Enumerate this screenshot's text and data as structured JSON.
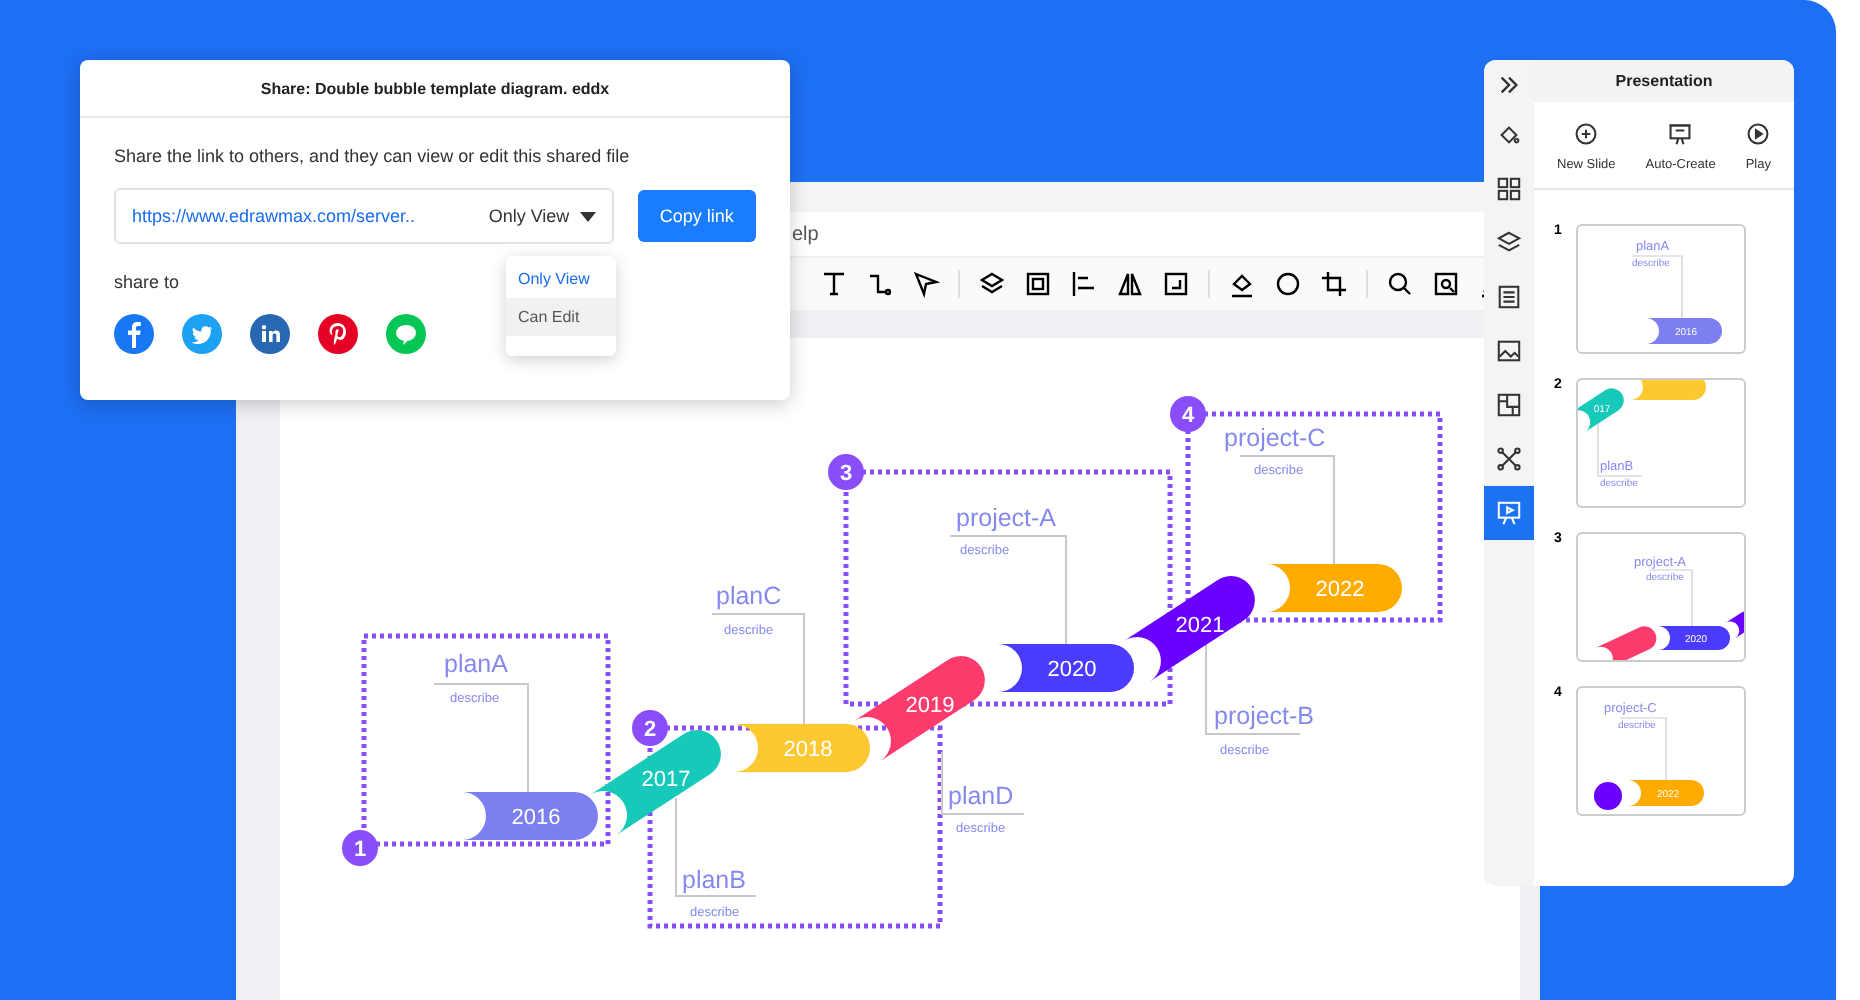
{
  "share_dialog": {
    "title": "Share: Double bubble template diagram. eddx",
    "message": "Share the link to others, and they can view or edit this shared file",
    "link_field": {
      "value": "https://www.edrawmax.com/server.."
    },
    "permission_select": {
      "value": "Only View"
    },
    "copy_button": "Copy link",
    "permission_options": [
      {
        "label": "Only View",
        "selected": true,
        "highlighted": false
      },
      {
        "label": "Can Edit",
        "selected": false,
        "highlighted": true
      }
    ],
    "share_label": "share to"
  },
  "editor": {
    "menu_text": "elp"
  },
  "diagram": {
    "frames": [
      {
        "number": "1"
      },
      {
        "number": "2"
      },
      {
        "number": "3"
      },
      {
        "number": "4"
      }
    ],
    "milestones": [
      {
        "year": "2016",
        "color": "#7b7fef"
      },
      {
        "year": "2017",
        "color": "#17c9b8"
      },
      {
        "year": "2018",
        "color": "#fdc830"
      },
      {
        "year": "2019",
        "color": "#fb3b6b"
      },
      {
        "year": "2020",
        "color": "#4b3bff"
      },
      {
        "year": "2021",
        "color": "#6a00ff"
      },
      {
        "year": "2022",
        "color": "#ffab00"
      }
    ],
    "labels": [
      {
        "title": "project-C",
        "caption": "describe"
      },
      {
        "title": "project-A",
        "caption": "describe"
      },
      {
        "title": "planC",
        "caption": "describe"
      },
      {
        "title": "planA",
        "caption": "describe"
      },
      {
        "title": "project-B",
        "caption": "describe"
      },
      {
        "title": "planD",
        "caption": "describe"
      },
      {
        "title": "planB",
        "caption": "describe"
      }
    ]
  },
  "presentation": {
    "title": "Presentation",
    "actions": [
      "New Slide",
      "Auto-Create",
      "Play"
    ],
    "tools": [
      {
        "selected": false
      },
      {
        "selected": false
      },
      {
        "selected": false
      },
      {
        "selected": false
      },
      {
        "selected": false
      },
      {
        "selected": false
      },
      {
        "selected": false
      },
      {
        "selected": true
      }
    ],
    "slides": [
      {
        "number": "1",
        "title": "planA",
        "caption": "describe",
        "pills": [
          {
            "text": "2016",
            "color": "#7b7fef"
          }
        ]
      },
      {
        "number": "2",
        "title": "planB",
        "caption": "describe",
        "pills": [
          {
            "text": "017",
            "color": "#17c9b8"
          },
          {
            "color": "#fdc830"
          }
        ]
      },
      {
        "number": "3",
        "title": "project-A",
        "caption": "describe",
        "pills": [
          {
            "color": "#fb3b6b"
          },
          {
            "text": "2020",
            "color": "#4b3bff"
          },
          {
            "color": "#6a00ff"
          }
        ]
      },
      {
        "number": "4",
        "title": "project-C",
        "caption": "describe",
        "pills": [
          {
            "color": "#6a00ff"
          },
          {
            "text": "2022",
            "color": "#ffab00"
          }
        ]
      }
    ]
  }
}
